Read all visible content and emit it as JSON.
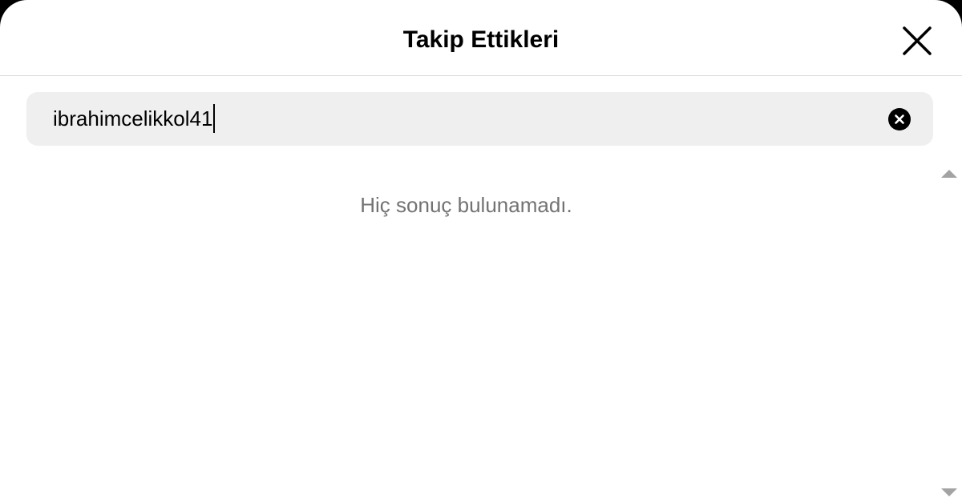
{
  "dialog": {
    "title": "Takip Ettikleri",
    "close_icon": "close-icon"
  },
  "search": {
    "value": "ibrahimcelikkol41",
    "clear_icon": "clear-circle-icon"
  },
  "results": {
    "empty_message": "Hiç sonuç bulunamadı."
  },
  "scrollbar": {
    "up_icon": "scroll-up-arrow-icon",
    "down_icon": "scroll-down-arrow-icon"
  },
  "colors": {
    "background": "#ffffff",
    "search_background": "#efefef",
    "muted_text": "#737373",
    "divider": "#dbdbdb",
    "scroll_arrow": "#a3a3a3"
  }
}
